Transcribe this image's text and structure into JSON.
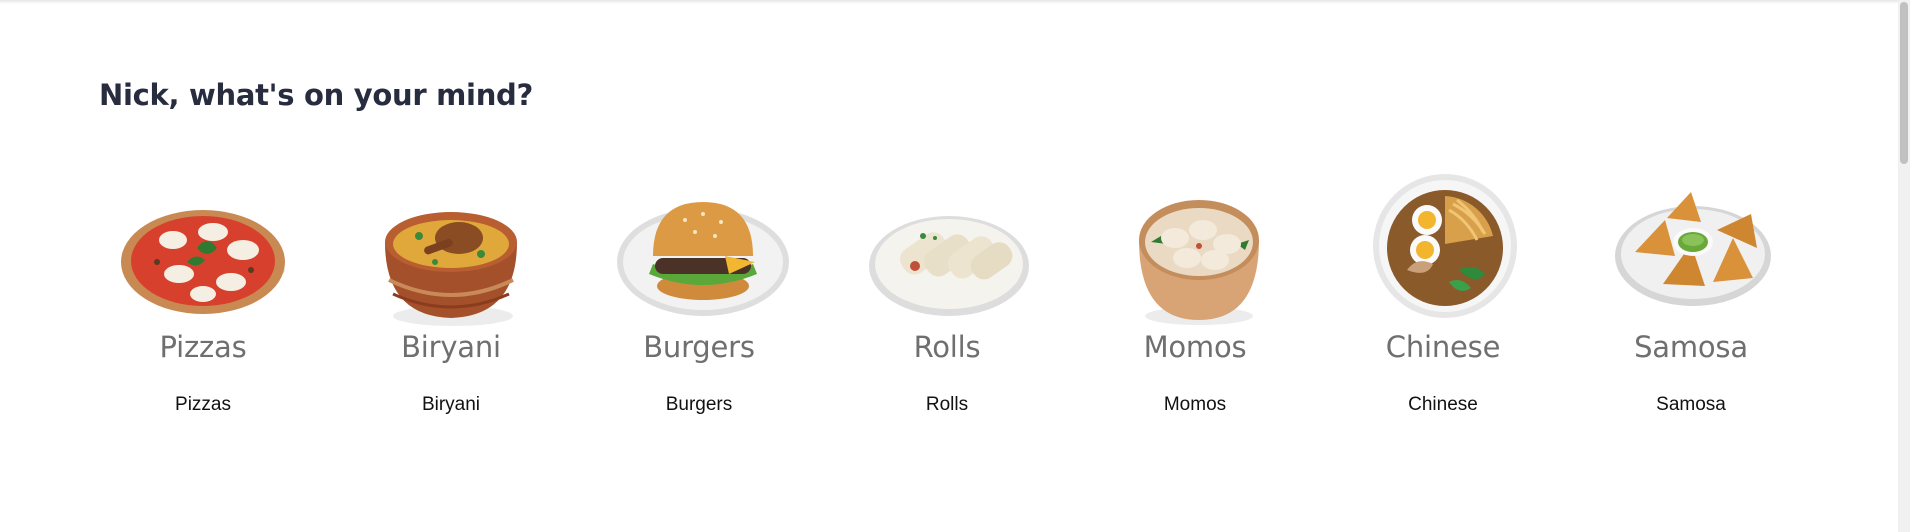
{
  "header": {
    "title": "Nick, what's on your mind?"
  },
  "categories": [
    {
      "icon": "pizza-icon",
      "image_label": "Pizzas",
      "label": "Pizzas"
    },
    {
      "icon": "biryani-icon",
      "image_label": "Biryani",
      "label": "Biryani"
    },
    {
      "icon": "burger-icon",
      "image_label": "Burgers",
      "label": "Burgers"
    },
    {
      "icon": "rolls-icon",
      "image_label": "Rolls",
      "label": "Rolls"
    },
    {
      "icon": "momos-icon",
      "image_label": "Momos",
      "label": "Momos"
    },
    {
      "icon": "chinese-icon",
      "image_label": "Chinese",
      "label": "Chinese"
    },
    {
      "icon": "samosa-icon",
      "image_label": "Samosa",
      "label": "Samosa"
    }
  ],
  "colors": {
    "heading": "#282c3f",
    "image_label": "#6f6f6f",
    "label": "#111111"
  }
}
